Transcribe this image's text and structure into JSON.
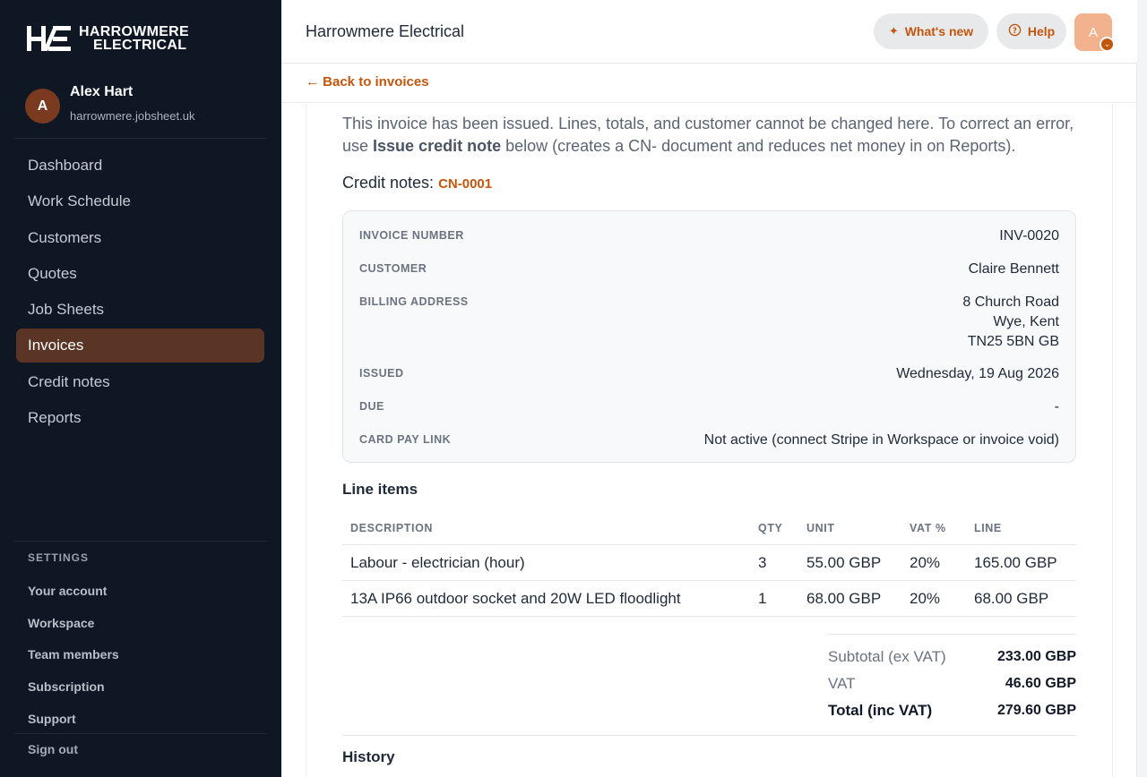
{
  "brand": {
    "line1": "HARROWMERE",
    "line2": "ELECTRICAL",
    "accent": "#c2560c",
    "sidebar_bg": "#0f1624"
  },
  "user": {
    "initial": "A",
    "name": "Alex Hart",
    "domain": "harrowmere.jobsheet.uk"
  },
  "nav": {
    "items": [
      {
        "label": "Dashboard",
        "active": false
      },
      {
        "label": "Work Schedule",
        "active": false
      },
      {
        "label": "Customers",
        "active": false
      },
      {
        "label": "Quotes",
        "active": false
      },
      {
        "label": "Job Sheets",
        "active": false
      },
      {
        "label": "Invoices",
        "active": true
      },
      {
        "label": "Credit notes",
        "active": false
      },
      {
        "label": "Reports",
        "active": false
      }
    ]
  },
  "settings": {
    "title": "SETTINGS",
    "items": [
      "Your account",
      "Workspace",
      "Team members",
      "Subscription",
      "Support"
    ],
    "signout": "Sign out"
  },
  "header": {
    "company": "Harrowmere Electrical",
    "whats_new": "What's new",
    "help": "Help",
    "avatar_initial": "A"
  },
  "back": {
    "label": "← Back to invoices"
  },
  "notice": {
    "before": "This invoice has been issued. Lines, totals, and customer cannot be changed here. To correct an error, use ",
    "bold": "Issue credit note",
    "after": " below (creates a CN- document and reduces net money in on Reports)."
  },
  "credit_notes": {
    "label": "Credit notes: ",
    "link": "CN-0001"
  },
  "details": {
    "invoice_number_label": "INVOICE NUMBER",
    "invoice_number": "INV-0020",
    "customer_label": "CUSTOMER",
    "customer": "Claire Bennett",
    "billing_label": "BILLING ADDRESS",
    "billing_line1": "8 Church Road",
    "billing_line2": "Wye, Kent",
    "billing_line3": "TN25 5BN GB",
    "issued_label": "ISSUED",
    "issued": "Wednesday, 19 Aug 2026",
    "due_label": "DUE",
    "due": "-",
    "cardpay_label": "CARD PAY LINK",
    "cardpay": "Not active (connect Stripe in Workspace or invoice void)"
  },
  "line_items": {
    "title": "Line items",
    "headers": {
      "description": "DESCRIPTION",
      "qty": "QTY",
      "unit": "UNIT",
      "vat": "VAT %",
      "line": "LINE"
    },
    "rows": [
      {
        "description": "Labour - electrician (hour)",
        "qty": "3",
        "unit": "55.00 GBP",
        "vat": "20%",
        "line": "165.00 GBP"
      },
      {
        "description": "13A IP66 outdoor socket and 20W LED floodlight",
        "qty": "1",
        "unit": "68.00 GBP",
        "vat": "20%",
        "line": "68.00 GBP"
      }
    ]
  },
  "totals": {
    "subtotal_label": "Subtotal (ex VAT)",
    "subtotal": "233.00 GBP",
    "vat_label": "VAT",
    "vat": "46.60 GBP",
    "total_label": "Total (inc VAT)",
    "total": "279.60 GBP"
  },
  "history": {
    "title": "History"
  }
}
